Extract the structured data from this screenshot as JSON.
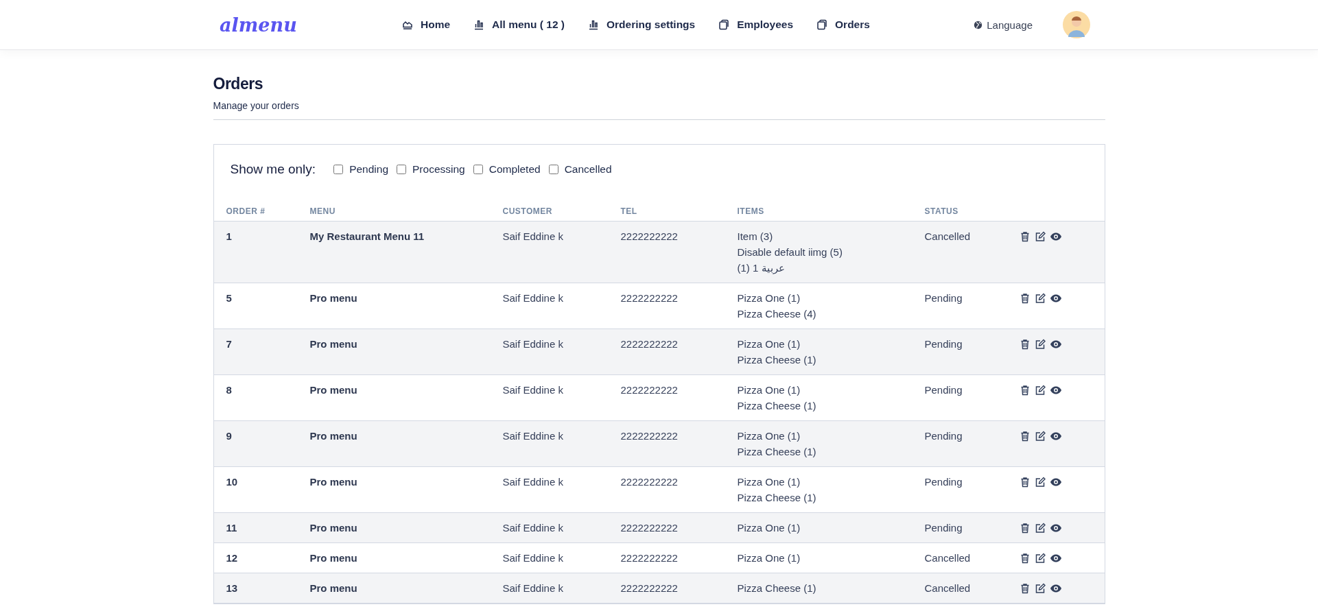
{
  "header": {
    "logo": "almenu",
    "nav": [
      {
        "label": "Home",
        "kind": "area"
      },
      {
        "label": "All menu ( 12 )",
        "kind": "bars"
      },
      {
        "label": "Ordering settings",
        "kind": "bars"
      },
      {
        "label": "Employees",
        "kind": "copy"
      },
      {
        "label": "Orders",
        "kind": "copy"
      }
    ],
    "language": "Language"
  },
  "page": {
    "title": "Orders",
    "subtitle": "Manage your orders"
  },
  "filter": {
    "label": "Show me only:",
    "options": [
      {
        "label": "Pending",
        "checked": false
      },
      {
        "label": "Processing",
        "checked": false
      },
      {
        "label": "Completed",
        "checked": false
      },
      {
        "label": "Cancelled",
        "checked": false
      }
    ]
  },
  "table": {
    "columns": [
      "ORDER #",
      "MENU",
      "CUSTOMER",
      "TEL",
      "ITEMS",
      "STATUS"
    ],
    "rows": [
      {
        "order": "1",
        "menu": "My Restaurant Menu 11",
        "customer": "Saif Eddine k",
        "tel": "2222222222",
        "items": [
          "Item (3)",
          "Disable default iimg (5)",
          "عربية 1 (1)"
        ],
        "status": "Cancelled"
      },
      {
        "order": "5",
        "menu": "Pro menu",
        "customer": "Saif Eddine k",
        "tel": "2222222222",
        "items": [
          "Pizza One (1)",
          "Pizza Cheese (4)"
        ],
        "status": "Pending"
      },
      {
        "order": "7",
        "menu": "Pro menu",
        "customer": "Saif Eddine k",
        "tel": "2222222222",
        "items": [
          "Pizza One (1)",
          "Pizza Cheese (1)"
        ],
        "status": "Pending"
      },
      {
        "order": "8",
        "menu": "Pro menu",
        "customer": "Saif Eddine k",
        "tel": "2222222222",
        "items": [
          "Pizza One (1)",
          "Pizza Cheese (1)"
        ],
        "status": "Pending"
      },
      {
        "order": "9",
        "menu": "Pro menu",
        "customer": "Saif Eddine k",
        "tel": "2222222222",
        "items": [
          "Pizza One (1)",
          "Pizza Cheese (1)"
        ],
        "status": "Pending"
      },
      {
        "order": "10",
        "menu": "Pro menu",
        "customer": "Saif Eddine k",
        "tel": "2222222222",
        "items": [
          "Pizza One (1)",
          "Pizza Cheese (1)"
        ],
        "status": "Pending"
      },
      {
        "order": "11",
        "menu": "Pro menu",
        "customer": "Saif Eddine k",
        "tel": "2222222222",
        "items": [
          "Pizza One (1)"
        ],
        "status": "Pending"
      },
      {
        "order": "12",
        "menu": "Pro menu",
        "customer": "Saif Eddine k",
        "tel": "2222222222",
        "items": [
          "Pizza One (1)"
        ],
        "status": "Cancelled"
      },
      {
        "order": "13",
        "menu": "Pro menu",
        "customer": "Saif Eddine k",
        "tel": "2222222222",
        "items": [
          "Pizza Cheese (1)"
        ],
        "status": "Cancelled"
      }
    ]
  }
}
